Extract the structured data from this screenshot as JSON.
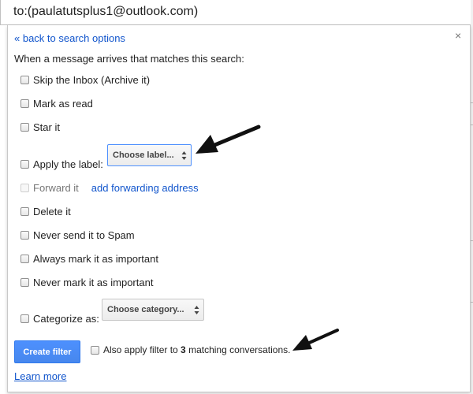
{
  "search": {
    "query": "to:(paulatutsplus1@outlook.com)"
  },
  "panel": {
    "back_link": "« back to search options",
    "close_symbol": "×",
    "intro": "When a message arrives that matches this search:",
    "options": [
      {
        "label": "Skip the Inbox (Archive it)",
        "checked": false
      },
      {
        "label": "Mark as read",
        "checked": false
      },
      {
        "label": "Star it",
        "checked": false
      },
      {
        "label": "Apply the label:",
        "checked": false
      },
      {
        "label": "Forward it",
        "checked": false,
        "disabled": true
      },
      {
        "label": "Delete it",
        "checked": false
      },
      {
        "label": "Never send it to Spam",
        "checked": false
      },
      {
        "label": "Always mark it as important",
        "checked": false
      },
      {
        "label": "Never mark it as important",
        "checked": false
      },
      {
        "label": "Categorize as:",
        "checked": false
      }
    ],
    "label_select": "Choose label...",
    "forward_link": "add forwarding address",
    "category_select": "Choose category...",
    "create_button": "Create filter",
    "also_apply_prefix": "Also apply filter to ",
    "also_apply_count": "3",
    "also_apply_suffix": " matching conversations.",
    "learn_more": "Learn more"
  },
  "colors": {
    "link": "#1155cc",
    "primary_button": "#4d90fe",
    "focus_border": "#4d90fe"
  }
}
